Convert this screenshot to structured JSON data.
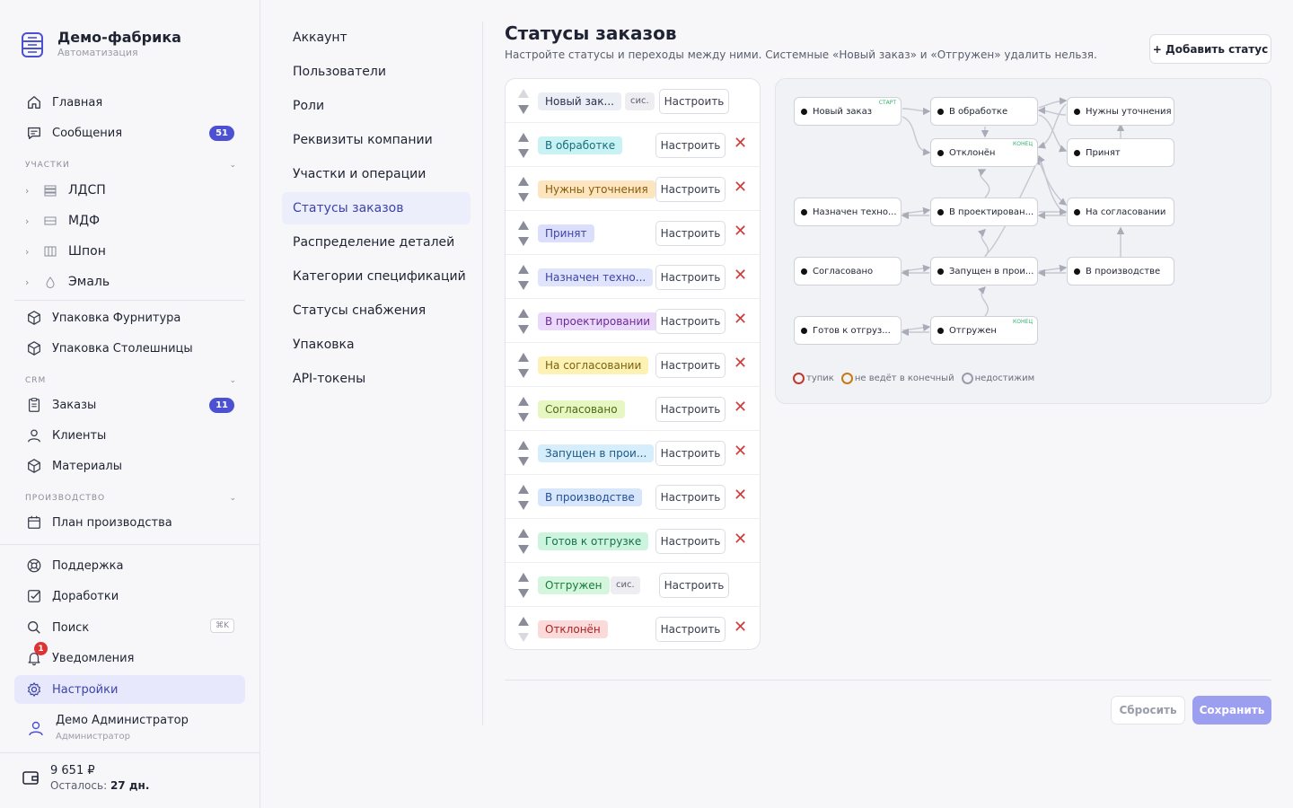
{
  "brand": {
    "title": "Демо-фабрика",
    "subtitle": "Автоматизация"
  },
  "sidebar": {
    "home": "Главная",
    "messages": {
      "label": "Сообщения",
      "badge": "51"
    },
    "section_areas": "УЧАСТКИ",
    "areas": [
      "ЛДСП",
      "МДФ",
      "Шпон",
      "Эмаль"
    ],
    "packing_hardware": "Упаковка Фурнитура",
    "packing_tops": "Упаковка Столешницы",
    "section_crm": "CRM",
    "orders": {
      "label": "Заказы",
      "badge": "11"
    },
    "clients": "Клиенты",
    "materials": "Материалы",
    "section_production": "ПРОИЗВОДСТВО",
    "production_plan": "План производства",
    "support": "Поддержка",
    "improvements": "Доработки",
    "search": {
      "label": "Поиск",
      "shortcut": "⌘K"
    },
    "notifications": {
      "label": "Уведомления",
      "count": "1"
    },
    "settings": "Настройки",
    "user": {
      "name": "Демо Администратор",
      "role": "Администратор"
    },
    "balance": {
      "amount": "9 651 ₽",
      "left_label": "Осталось:",
      "left_value": "27 дн."
    }
  },
  "settings_nav": [
    "Аккаунт",
    "Пользователи",
    "Роли",
    "Реквизиты компании",
    "Участки и операции",
    "Статусы заказов",
    "Распределение деталей",
    "Категории спецификаций",
    "Статусы снабжения",
    "Упаковка",
    "API-токены"
  ],
  "page": {
    "title": "Статусы заказов",
    "description": "Настройте статусы и переходы между ними. Системные «Новый заказ» и «Отгружен» удалить нельзя.",
    "add_button": "+ Добавить статус",
    "configure_label": "Настроить",
    "system_tag": "сис.",
    "reset_button": "Сбросить",
    "save_button": "Сохранить"
  },
  "statuses": [
    {
      "label": "Новый зак...",
      "system": true,
      "bg": "#eceef5",
      "fg": "#2d3150"
    },
    {
      "label": "В обработке",
      "system": false,
      "bg": "#c9f2f4",
      "fg": "#16707a"
    },
    {
      "label": "Нужны уточнения",
      "system": false,
      "bg": "#fde6bf",
      "fg": "#8a5a0d"
    },
    {
      "label": "Принят",
      "system": false,
      "bg": "#dcdffb",
      "fg": "#3d44a8"
    },
    {
      "label": "Назначен техно...",
      "system": false,
      "bg": "#dfe3fb",
      "fg": "#3d44a8"
    },
    {
      "label": "В проектировании",
      "system": false,
      "bg": "#ead9f8",
      "fg": "#6b2a9a"
    },
    {
      "label": "На согласовании",
      "system": false,
      "bg": "#fdf2b3",
      "fg": "#7a6210"
    },
    {
      "label": "Согласовано",
      "system": false,
      "bg": "#e7f7c3",
      "fg": "#4e6b10"
    },
    {
      "label": "Запущен в прои...",
      "system": false,
      "bg": "#d6edfb",
      "fg": "#1d5a86"
    },
    {
      "label": "В производстве",
      "system": false,
      "bg": "#d7e6fb",
      "fg": "#234e9a"
    },
    {
      "label": "Готов к отгрузке",
      "system": false,
      "bg": "#cdf5de",
      "fg": "#17704a"
    },
    {
      "label": "Отгружен",
      "system": true,
      "bg": "#d3f6dd",
      "fg": "#1a7a3f"
    },
    {
      "label": "Отклонён",
      "system": false,
      "bg": "#fcdada",
      "fg": "#a82424"
    }
  ],
  "graph": {
    "nodes": [
      {
        "label": "Новый заказ",
        "tag": "СТАРТ"
      },
      {
        "label": "В обработке",
        "tag": ""
      },
      {
        "label": "Нужны уточнения",
        "tag": ""
      },
      {
        "label": "Отклонён",
        "tag": "КОНЕЦ"
      },
      {
        "label": "Принят",
        "tag": ""
      },
      {
        "label": "Назначен техно...",
        "tag": ""
      },
      {
        "label": "В проектирован...",
        "tag": ""
      },
      {
        "label": "На согласовании",
        "tag": ""
      },
      {
        "label": "Согласовано",
        "tag": ""
      },
      {
        "label": "Запущен в прои...",
        "tag": ""
      },
      {
        "label": "В производстве",
        "tag": ""
      },
      {
        "label": "Готов к отгруз...",
        "tag": ""
      },
      {
        "label": "Отгружен",
        "tag": "КОНЕЦ"
      }
    ],
    "legend": [
      {
        "label": "тупик",
        "color": "#c0392b"
      },
      {
        "label": "не ведёт в конечный",
        "color": "#c77a12"
      },
      {
        "label": "недостижим",
        "color": "#9a9caa"
      }
    ]
  }
}
